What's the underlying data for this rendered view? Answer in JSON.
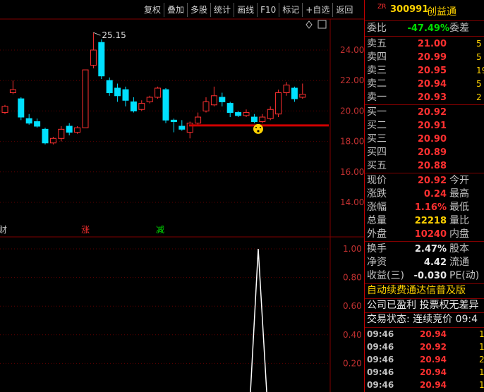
{
  "toolbar": [
    "复权",
    "叠加",
    "多股",
    "统计",
    "画线",
    "F10",
    "标记",
    "+自选",
    "返回"
  ],
  "stock": {
    "badge": "ZR",
    "code": "300991",
    "name": "创益通"
  },
  "chart": {
    "price_axis": [
      "24.00",
      "22.00",
      "20.00",
      "18.00",
      "16.00",
      "14.00"
    ],
    "peak_label": "25.15",
    "markers": {
      "cai": "财",
      "zhang": "涨",
      "jian": "减"
    },
    "indicator_axis": [
      "1.00",
      "0.80",
      "0.60",
      "0.40",
      "0.20"
    ],
    "candles": [
      {
        "o": 19.9,
        "c": 20.3,
        "h": 20.4,
        "l": 19.8
      },
      {
        "o": 21.2,
        "c": 21.4,
        "h": 22.0,
        "l": 21.1
      },
      {
        "o": 20.8,
        "c": 19.6,
        "h": 20.9,
        "l": 19.4
      },
      {
        "o": 19.5,
        "c": 19.2,
        "h": 19.8,
        "l": 19.1
      },
      {
        "o": 19.3,
        "c": 19.0,
        "h": 19.5,
        "l": 18.9
      },
      {
        "o": 18.8,
        "c": 17.9,
        "h": 18.9,
        "l": 17.8
      },
      {
        "o": 17.9,
        "c": 18.2,
        "h": 18.3,
        "l": 17.8
      },
      {
        "o": 18.2,
        "c": 18.8,
        "h": 19.0,
        "l": 18.0
      },
      {
        "o": 19.0,
        "c": 18.6,
        "h": 19.2,
        "l": 18.4
      },
      {
        "o": 18.6,
        "c": 18.9,
        "h": 19.0,
        "l": 18.5
      },
      {
        "o": 18.9,
        "c": 22.7,
        "h": 22.7,
        "l": 18.9
      },
      {
        "o": 23.0,
        "c": 24.0,
        "h": 25.15,
        "l": 22.8
      },
      {
        "o": 24.5,
        "c": 22.3,
        "h": 24.7,
        "l": 22.1
      },
      {
        "o": 22.0,
        "c": 21.2,
        "h": 22.2,
        "l": 21.0
      },
      {
        "o": 21.5,
        "c": 21.0,
        "h": 21.8,
        "l": 20.6
      },
      {
        "o": 21.4,
        "c": 20.7,
        "h": 21.6,
        "l": 20.3
      },
      {
        "o": 20.6,
        "c": 20.0,
        "h": 20.9,
        "l": 19.9
      },
      {
        "o": 20.1,
        "c": 20.5,
        "h": 20.7,
        "l": 20.0
      },
      {
        "o": 20.6,
        "c": 20.9,
        "h": 21.0,
        "l": 20.5
      },
      {
        "o": 20.9,
        "c": 21.5,
        "h": 21.6,
        "l": 20.8
      },
      {
        "o": 21.4,
        "c": 19.4,
        "h": 21.5,
        "l": 19.2
      },
      {
        "o": 19.4,
        "c": 19.3,
        "h": 19.5,
        "l": 18.6
      },
      {
        "o": 19.0,
        "c": 18.8,
        "h": 19.4,
        "l": 18.7
      },
      {
        "o": 18.6,
        "c": 19.2,
        "h": 19.3,
        "l": 18.2
      },
      {
        "o": 19.2,
        "c": 19.6,
        "h": 19.9,
        "l": 19.1
      },
      {
        "o": 20.0,
        "c": 20.6,
        "h": 20.9,
        "l": 19.9
      },
      {
        "o": 20.4,
        "c": 21.0,
        "h": 21.6,
        "l": 20.3
      },
      {
        "o": 20.9,
        "c": 20.6,
        "h": 21.2,
        "l": 20.3
      },
      {
        "o": 20.5,
        "c": 19.9,
        "h": 20.6,
        "l": 19.6
      },
      {
        "o": 19.9,
        "c": 19.7,
        "h": 20.0,
        "l": 19.6
      },
      {
        "o": 19.7,
        "c": 19.9,
        "h": 20.1,
        "l": 19.6
      },
      {
        "o": 19.6,
        "c": 19.3,
        "h": 19.8,
        "l": 19.2
      },
      {
        "o": 19.3,
        "c": 19.6,
        "h": 19.8,
        "l": 19.2
      },
      {
        "o": 19.5,
        "c": 20.1,
        "h": 20.3,
        "l": 19.4
      },
      {
        "o": 19.8,
        "c": 21.2,
        "h": 21.4,
        "l": 19.6
      },
      {
        "o": 21.2,
        "c": 21.7,
        "h": 21.9,
        "l": 21.0
      },
      {
        "o": 21.5,
        "c": 20.8,
        "h": 21.6,
        "l": 20.6
      },
      {
        "o": 20.9,
        "c": 21.1,
        "h": 21.8,
        "l": 20.8
      }
    ],
    "support_line": 19.05
  },
  "panel": {
    "weibi": {
      "label": "委比",
      "value": "-47.49%",
      "label2": "委差"
    },
    "asks": [
      {
        "label": "卖五",
        "price": "21.00",
        "vol": "5"
      },
      {
        "label": "卖四",
        "price": "20.99",
        "vol": "5"
      },
      {
        "label": "卖三",
        "price": "20.95",
        "vol": "19"
      },
      {
        "label": "卖二",
        "price": "20.94",
        "vol": "5"
      },
      {
        "label": "卖一",
        "price": "20.93",
        "vol": "2"
      }
    ],
    "bids": [
      {
        "label": "买一",
        "price": "20.92",
        "vol": ""
      },
      {
        "label": "买二",
        "price": "20.91",
        "vol": ""
      },
      {
        "label": "买三",
        "price": "20.90",
        "vol": ""
      },
      {
        "label": "买四",
        "price": "20.89",
        "vol": ""
      },
      {
        "label": "买五",
        "price": "20.88",
        "vol": ""
      }
    ],
    "stats": [
      {
        "label": "现价",
        "value": "20.92",
        "label2": "今开",
        "color": "red"
      },
      {
        "label": "涨跌",
        "value": "0.24",
        "label2": "最高",
        "color": "red"
      },
      {
        "label": "涨幅",
        "value": "1.16%",
        "label2": "最低",
        "color": "red"
      },
      {
        "label": "总量",
        "value": "22218",
        "label2": "量比",
        "color": "yellow"
      },
      {
        "label": "外盘",
        "value": "10240",
        "label2": "内盘",
        "color": "red"
      }
    ],
    "fin": [
      {
        "label": "换手",
        "value": "2.47%",
        "label2": "股本",
        "color": "white"
      },
      {
        "label": "净资",
        "value": "4.42",
        "label2": "流通",
        "color": "white"
      },
      {
        "label": "收益(三)",
        "value": "-0.030",
        "label2": "PE(动)",
        "color": "white"
      }
    ],
    "banner1": "自动续费通达信普及版",
    "banner2": "公司已盈利 投票权无差异",
    "banner3": "交易状态: 连续竞价 09:4",
    "ticks": [
      {
        "time": "09:46",
        "price": "20.94",
        "vol": "1"
      },
      {
        "time": "09:46",
        "price": "20.92",
        "vol": "1"
      },
      {
        "time": "09:46",
        "price": "20.94",
        "vol": "2"
      },
      {
        "time": "09:46",
        "price": "20.94",
        "vol": "1"
      },
      {
        "time": "09:46",
        "price": "20.94",
        "vol": "1"
      }
    ]
  }
}
